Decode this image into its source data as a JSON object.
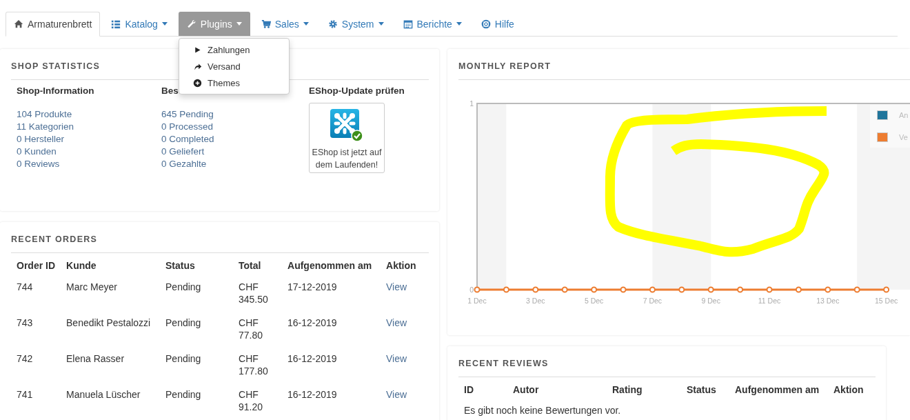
{
  "nav": {
    "tabs": [
      {
        "label": "Armaturenbrett",
        "selected": false,
        "active": true,
        "dropdown": false
      },
      {
        "label": "Katalog",
        "selected": false,
        "active": false,
        "dropdown": true
      },
      {
        "label": "Plugins",
        "selected": true,
        "active": false,
        "dropdown": true
      },
      {
        "label": "Sales",
        "selected": false,
        "active": false,
        "dropdown": true
      },
      {
        "label": "System",
        "selected": false,
        "active": false,
        "dropdown": true
      },
      {
        "label": "Berichte",
        "selected": false,
        "active": false,
        "dropdown": true
      },
      {
        "label": "Hilfe",
        "selected": false,
        "active": false,
        "dropdown": false
      }
    ],
    "open_menu": {
      "items": [
        {
          "label": "Zahlungen"
        },
        {
          "label": "Versand"
        },
        {
          "label": "Themes"
        }
      ]
    }
  },
  "shop_statistics": {
    "title": "SHOP STATISTICS",
    "columns": [
      {
        "heading": "Shop-Information",
        "links": [
          "104 Produkte",
          "11 Kategorien",
          "0 Hersteller",
          "0 Kunden",
          "0 Reviews"
        ]
      },
      {
        "heading": "Bes",
        "links": [
          "645 Pending",
          "0 Processed",
          "0 Completed",
          "0 Geliefert",
          "0 Gezahlte"
        ]
      }
    ],
    "update": {
      "heading": "EShop-Update prüfen",
      "message": "EShop ist jetzt auf dem Laufenden!",
      "up_to_date": true
    }
  },
  "recent_orders": {
    "title": "RECENT ORDERS",
    "columns": [
      "Order ID",
      "Kunde",
      "Status",
      "Total",
      "Aufgenommen am",
      "Aktion"
    ],
    "rows": [
      {
        "id": "744",
        "customer": "Marc Meyer",
        "status": "Pending",
        "currency": "CHF",
        "amount": "345.50",
        "date": "17-12-2019",
        "action": "View"
      },
      {
        "id": "743",
        "customer": "Benedikt Pestalozzi",
        "status": "Pending",
        "currency": "CHF",
        "amount": "77.80",
        "date": "16-12-2019",
        "action": "View"
      },
      {
        "id": "742",
        "customer": "Elena Rasser",
        "status": "Pending",
        "currency": "CHF",
        "amount": "177.80",
        "date": "16-12-2019",
        "action": "View"
      },
      {
        "id": "741",
        "customer": "Manuela Lüscher",
        "status": "Pending",
        "currency": "CHF",
        "amount": "91.20",
        "date": "16-12-2019",
        "action": "View"
      }
    ]
  },
  "monthly_report": {
    "title": "MONTHLY REPORT",
    "chart_data": {
      "type": "line",
      "categories": [
        "1 Dec",
        null,
        "3 Dec",
        null,
        "5 Dec",
        null,
        "7 Dec",
        null,
        "9 Dec",
        null,
        "11 Dec",
        null,
        "13 Dec",
        null,
        "15 Dec"
      ],
      "ylim": [
        0,
        1
      ],
      "yticks": [
        0,
        1
      ],
      "legend": "upper right",
      "series": [
        {
          "name": "An",
          "color": "#21759b",
          "values": [
            null,
            null,
            null,
            null,
            null,
            null,
            null,
            null,
            null,
            null,
            null,
            null,
            null,
            null,
            null
          ]
        },
        {
          "name": "Ve",
          "color": "#ed7d31",
          "marker": "circle",
          "values": [
            0,
            0,
            0,
            0,
            0,
            0,
            0,
            0,
            0,
            0,
            0,
            0,
            0,
            0,
            0
          ]
        }
      ]
    },
    "annotation": {
      "kind": "scribble",
      "color": "#ffff00"
    }
  },
  "recent_reviews": {
    "title": "RECENT REVIEWS",
    "columns": [
      "ID",
      "Autor",
      "Rating",
      "Status",
      "Aufgenommen am",
      "Aktion"
    ],
    "empty_message": "Es gibt noch keine Bewertungen vor."
  }
}
